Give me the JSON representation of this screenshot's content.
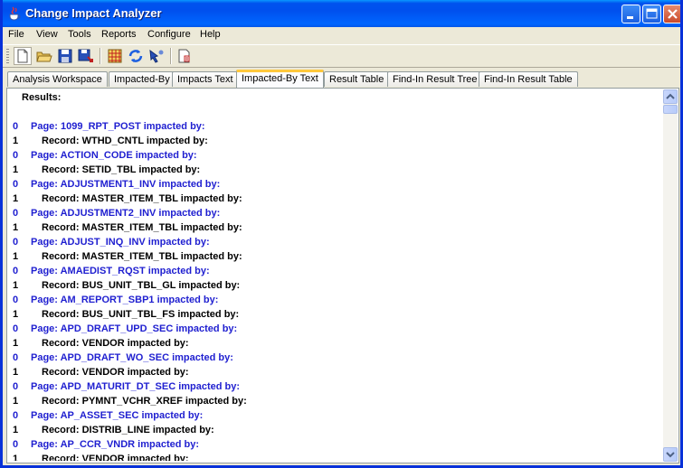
{
  "window": {
    "title": "Change Impact Analyzer",
    "icon": "java-cup-icon"
  },
  "menu": [
    "File",
    "View",
    "Tools",
    "Reports",
    "Configure",
    "Help"
  ],
  "toolbar": {
    "icons": [
      "new-icon",
      "open-icon",
      "save-icon",
      "save-as-icon",
      "grid-icon",
      "refresh-icon",
      "run-icon",
      "report-icon"
    ]
  },
  "tabs": [
    {
      "label": "Analysis Workspace",
      "active": false
    },
    {
      "label": "Impacted-By",
      "active": false
    },
    {
      "label": "Impacts Text",
      "active": false
    },
    {
      "label": "Impacted-By Text",
      "active": true
    },
    {
      "label": "Result Table",
      "active": false
    },
    {
      "label": "Find-In Result Tree",
      "active": false
    },
    {
      "label": "Find-In Result Table",
      "active": false
    }
  ],
  "results": {
    "header": "Results:",
    "lines": [
      {
        "level": "0",
        "text": "Page: 1099_RPT_POST impacted by:"
      },
      {
        "level": "1",
        "text": "Record: WTHD_CNTL impacted by:"
      },
      {
        "level": "0",
        "text": "Page: ACTION_CODE impacted by:"
      },
      {
        "level": "1",
        "text": "Record: SETID_TBL impacted by:"
      },
      {
        "level": "0",
        "text": "Page: ADJUSTMENT1_INV impacted by:"
      },
      {
        "level": "1",
        "text": "Record: MASTER_ITEM_TBL impacted by:"
      },
      {
        "level": "0",
        "text": "Page: ADJUSTMENT2_INV impacted by:"
      },
      {
        "level": "1",
        "text": "Record: MASTER_ITEM_TBL impacted by:"
      },
      {
        "level": "0",
        "text": "Page: ADJUST_INQ_INV impacted by:"
      },
      {
        "level": "1",
        "text": "Record: MASTER_ITEM_TBL impacted by:"
      },
      {
        "level": "0",
        "text": "Page: AMAEDIST_RQST impacted by:"
      },
      {
        "level": "1",
        "text": "Record: BUS_UNIT_TBL_GL impacted by:"
      },
      {
        "level": "0",
        "text": "Page: AM_REPORT_SBP1 impacted by:"
      },
      {
        "level": "1",
        "text": "Record: BUS_UNIT_TBL_FS impacted by:"
      },
      {
        "level": "0",
        "text": "Page: APD_DRAFT_UPD_SEC impacted by:"
      },
      {
        "level": "1",
        "text": "Record: VENDOR impacted by:"
      },
      {
        "level": "0",
        "text": "Page: APD_DRAFT_WO_SEC impacted by:"
      },
      {
        "level": "1",
        "text": "Record: VENDOR impacted by:"
      },
      {
        "level": "0",
        "text": "Page: APD_MATURIT_DT_SEC impacted by:"
      },
      {
        "level": "1",
        "text": "Record: PYMNT_VCHR_XREF impacted by:"
      },
      {
        "level": "0",
        "text": "Page: AP_ASSET_SEC impacted by:"
      },
      {
        "level": "1",
        "text": "Record: DISTRIB_LINE impacted by:"
      },
      {
        "level": "0",
        "text": "Page: AP_CCR_VNDR impacted by:"
      },
      {
        "level": "1",
        "text": "Record: VENDOR impacted by:"
      }
    ]
  },
  "colors": {
    "page_line": "#1f1fd0",
    "record_line": "#000000",
    "title_bar": "#0053ee",
    "active_tab_accent": "#ffc83c"
  }
}
